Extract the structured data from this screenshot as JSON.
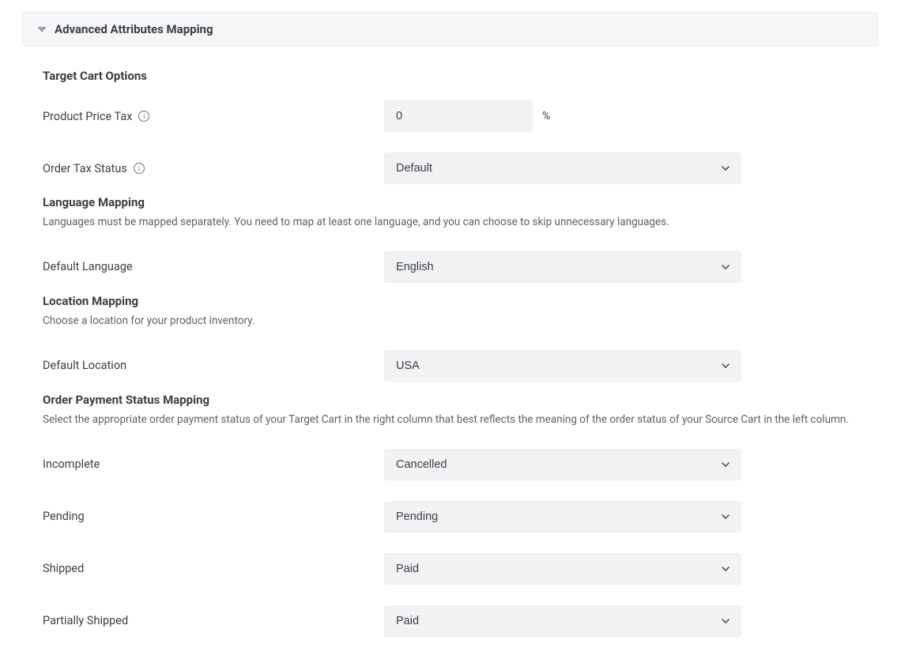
{
  "panel": {
    "title": "Advanced Attributes Mapping"
  },
  "target_cart": {
    "section_title": "Target Cart Options",
    "product_price_tax_label": "Product Price Tax",
    "product_price_tax_value": "0",
    "product_price_tax_suffix": "%",
    "order_tax_status_label": "Order Tax Status",
    "order_tax_status_value": "Default"
  },
  "language_mapping": {
    "section_title": "Language Mapping",
    "section_desc": "Languages must be mapped separately. You need to map at least one language, and you can choose to skip unnecessary languages.",
    "default_language_label": "Default Language",
    "default_language_value": "English"
  },
  "location_mapping": {
    "section_title": "Location Mapping",
    "section_desc": "Choose a location for your product inventory.",
    "default_location_label": "Default Location",
    "default_location_value": "USA"
  },
  "order_payment_status": {
    "section_title": "Order Payment Status Mapping",
    "section_desc": "Select the appropriate order payment status of your Target Cart in the right column that best reflects the meaning of the order status of your Source Cart in the left column.",
    "incomplete_label": "Incomplete",
    "incomplete_value": "Cancelled",
    "pending_label": "Pending",
    "pending_value": "Pending",
    "shipped_label": "Shipped",
    "shipped_value": "Paid",
    "partially_shipped_label": "Partially Shipped",
    "partially_shipped_value": "Paid"
  }
}
